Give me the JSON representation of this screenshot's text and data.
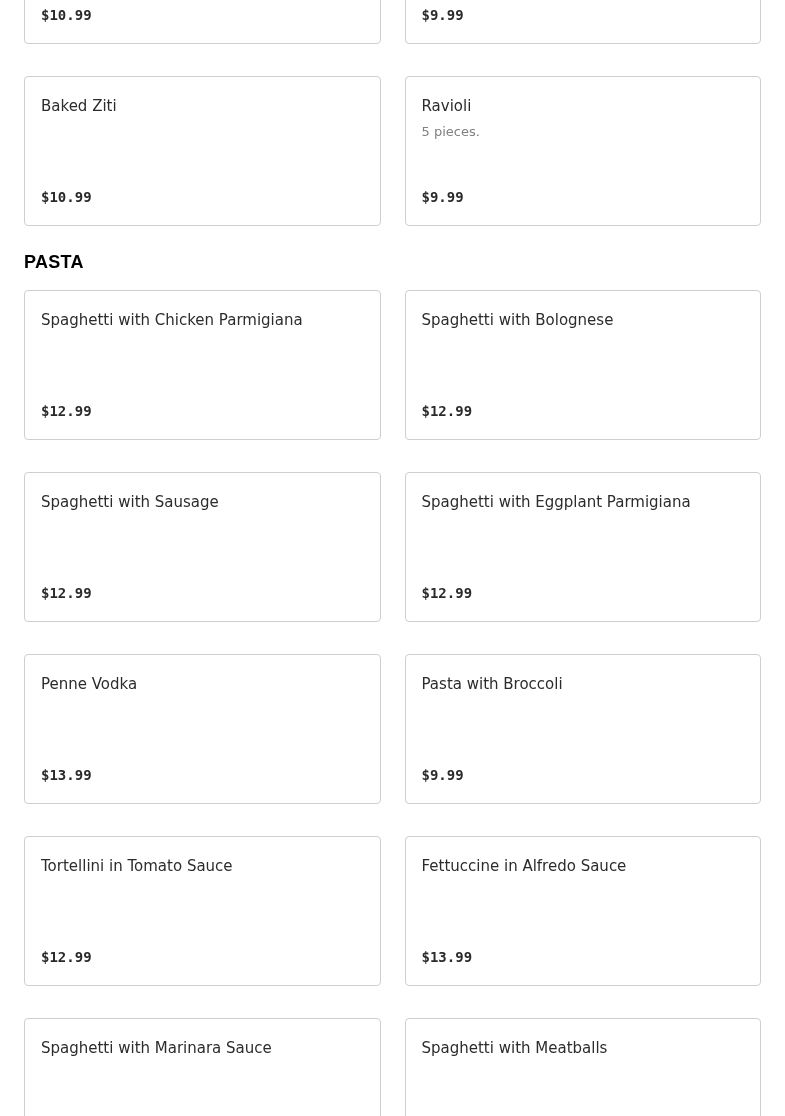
{
  "sections": [
    {
      "items": [
        {
          "price": "$10.99"
        },
        {
          "price": "$9.99"
        },
        {
          "name": "Baked Ziti",
          "price": "$10.99"
        },
        {
          "name": "Ravioli",
          "description": "5 pieces.",
          "price": "$9.99"
        }
      ]
    },
    {
      "title": "PASTA",
      "items": [
        {
          "name": "Spaghetti with Chicken Parmigiana",
          "price": "$12.99"
        },
        {
          "name": "Spaghetti with Bolognese",
          "price": "$12.99"
        },
        {
          "name": "Spaghetti with Sausage",
          "price": "$12.99"
        },
        {
          "name": "Spaghetti with Eggplant Parmigiana",
          "price": "$12.99"
        },
        {
          "name": "Penne Vodka",
          "price": "$13.99"
        },
        {
          "name": "Pasta with Broccoli",
          "price": "$9.99"
        },
        {
          "name": "Tortellini in Tomato Sauce",
          "price": "$12.99"
        },
        {
          "name": "Fettuccine in Alfredo Sauce",
          "price": "$13.99"
        },
        {
          "name": "Spaghetti with Marinara Sauce"
        },
        {
          "name": "Spaghetti with Meatballs"
        }
      ]
    }
  ]
}
